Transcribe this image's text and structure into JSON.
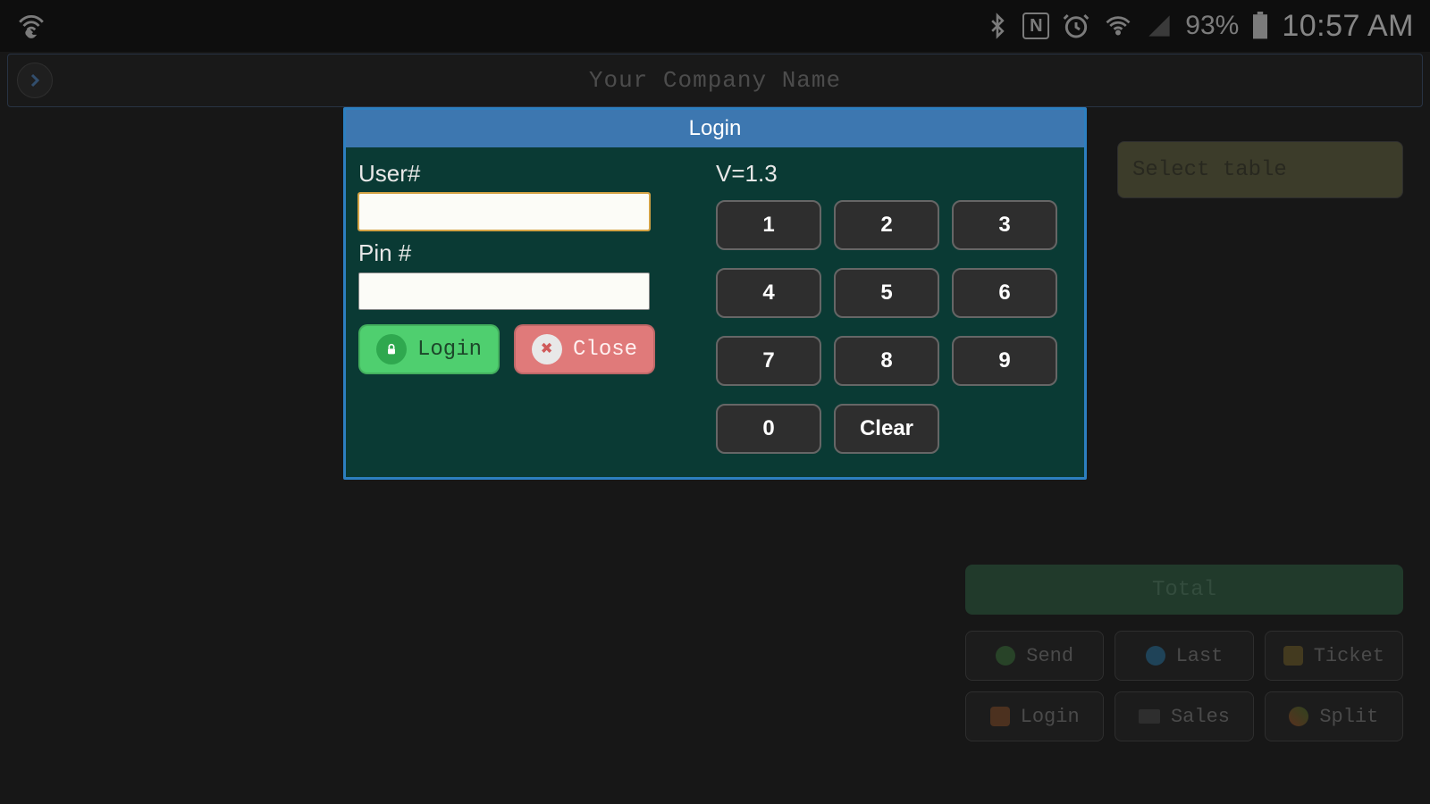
{
  "status": {
    "battery_pct": "93%",
    "clock": "10:57 AM"
  },
  "header": {
    "title": "Your Company Name"
  },
  "background": {
    "select_table": "Select table",
    "total": "Total",
    "actions": {
      "send": "Send",
      "last": "Last",
      "ticket": "Ticket",
      "login": "Login",
      "sales": "Sales",
      "split": "Split"
    }
  },
  "dialog": {
    "title": "Login",
    "user_label": "User#",
    "pin_label": "Pin #",
    "user_value": "",
    "pin_value": "",
    "version": "V=1.3",
    "login_label": "Login",
    "close_label": "Close",
    "keys": {
      "k1": "1",
      "k2": "2",
      "k3": "3",
      "k4": "4",
      "k5": "5",
      "k6": "6",
      "k7": "7",
      "k8": "8",
      "k9": "9",
      "k0": "0",
      "clear": "Clear"
    }
  }
}
